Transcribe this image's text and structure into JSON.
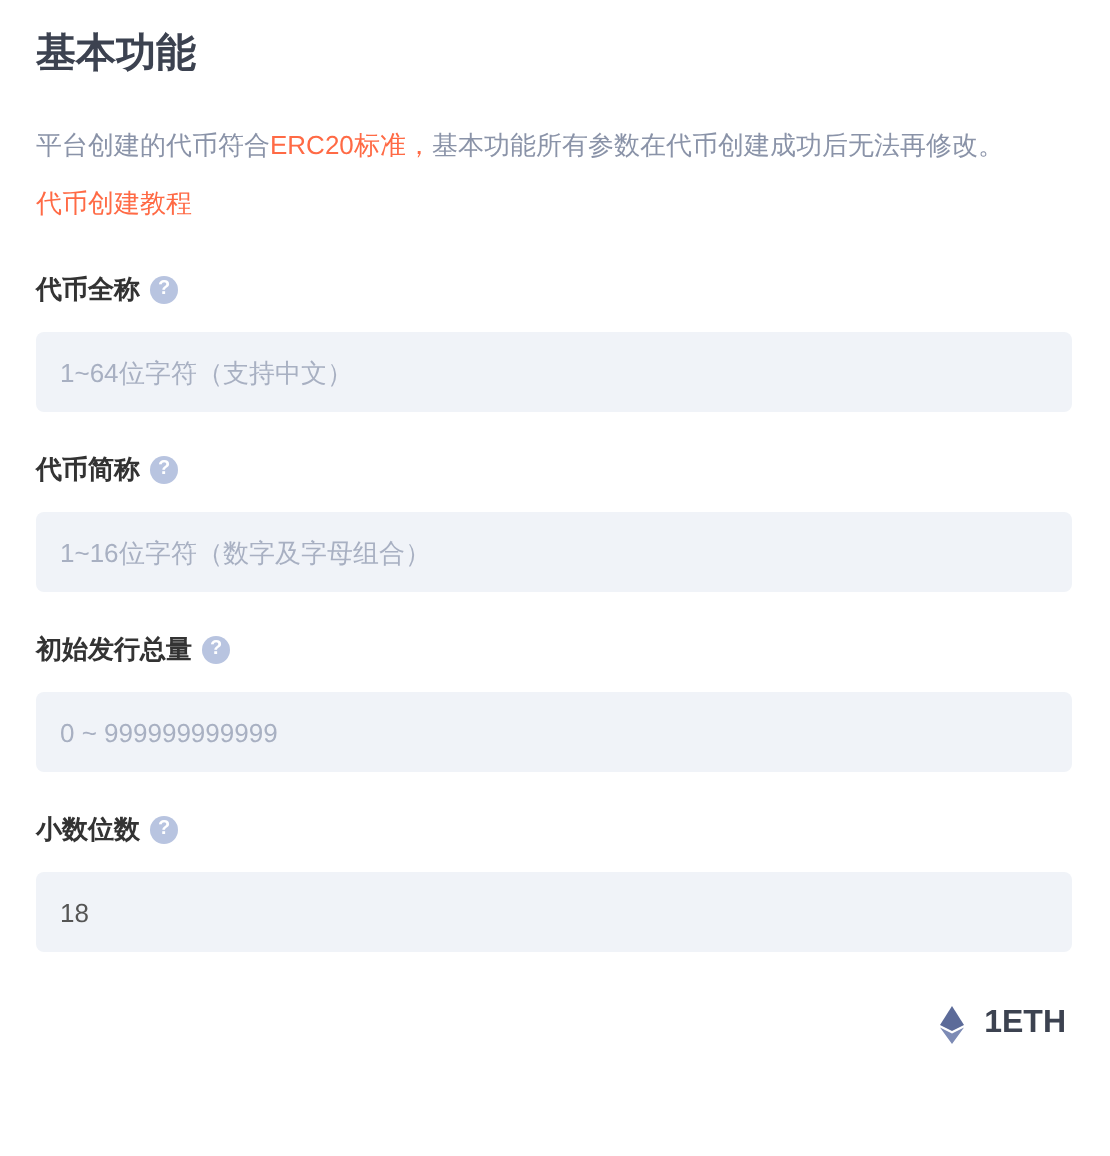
{
  "title": "基本功能",
  "description": [
    {
      "kind": "plain",
      "text": "平台创建的代币符合"
    },
    {
      "kind": "highlight",
      "text": "ERC20标准，"
    },
    {
      "kind": "plain",
      "text": "基本功能所有参数在代币创建成功后无法再修改。"
    },
    {
      "kind": "link",
      "text": "代币创建教程"
    }
  ],
  "fields": [
    {
      "label": "代币全称",
      "help": "?",
      "placeholder": "1~64位字符（支持中文）"
    },
    {
      "label": "代币简称",
      "help": "?",
      "placeholder": "1~16位字符（数字及字母组合）"
    },
    {
      "label": "初始发行总量",
      "help": "?",
      "placeholder": "0 ~ 999999999999"
    },
    {
      "label": "小数位数",
      "help": "?",
      "value": "18"
    }
  ],
  "fee": "1ETH"
}
